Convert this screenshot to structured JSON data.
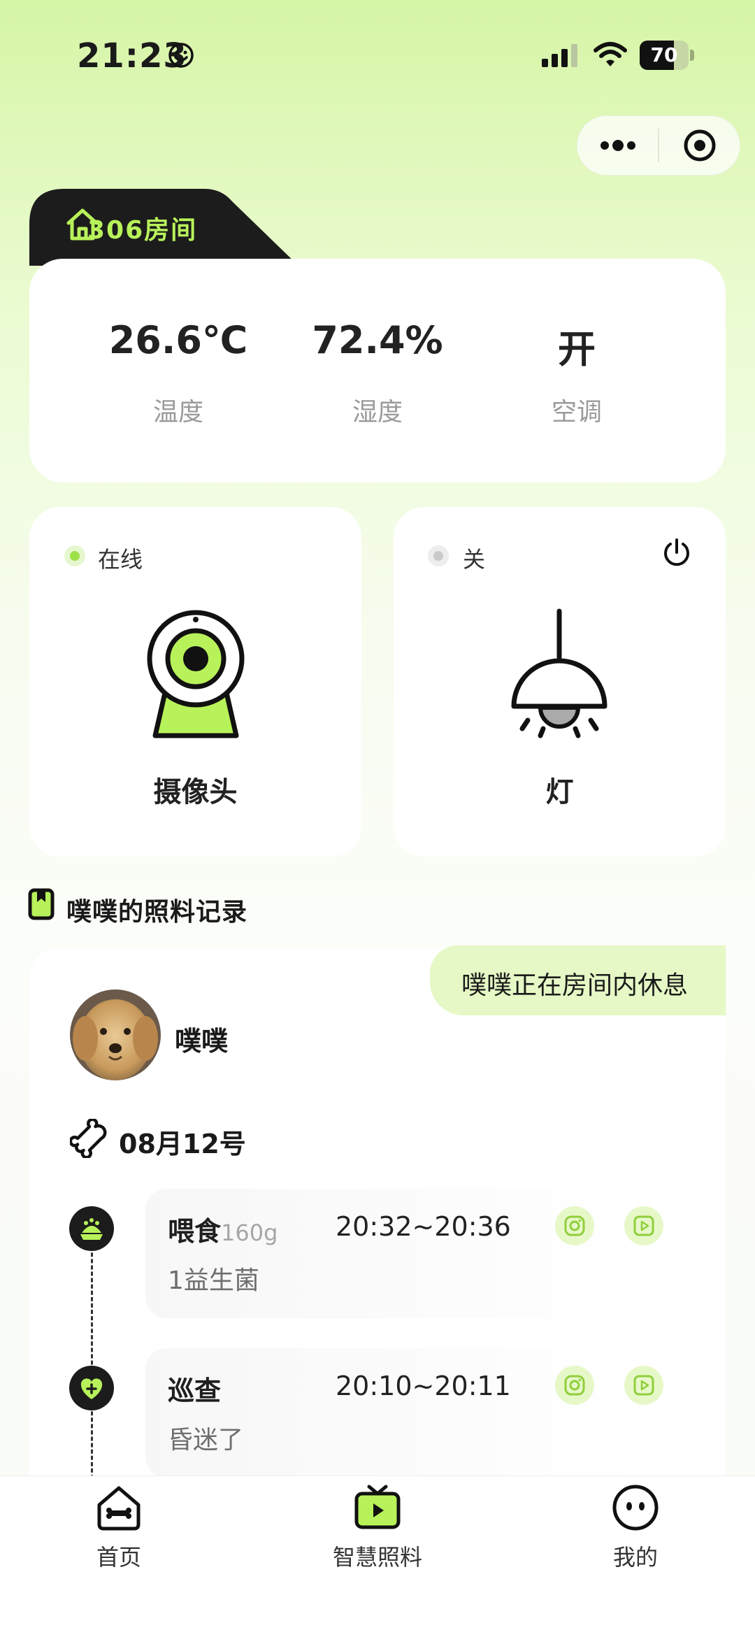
{
  "status_bar": {
    "time": "21:23",
    "battery": "70",
    "battery_level": 0.7
  },
  "room": {
    "title": "306房间"
  },
  "stats": [
    {
      "value": "26.6℃",
      "label": "温度"
    },
    {
      "value": "72.4%",
      "label": "湿度"
    },
    {
      "value": "开",
      "label": "空调"
    }
  ],
  "devices": {
    "camera": {
      "status": "在线",
      "name": "摄像头",
      "status_color": "#9ee04a"
    },
    "light": {
      "status": "关",
      "name": "灯",
      "status_color": "#c9c9c9"
    }
  },
  "section": {
    "title": "噗噗的照料记录"
  },
  "pet": {
    "name": "噗噗",
    "status_message": "噗噗正在房间内休息"
  },
  "date": "08月12号",
  "records": [
    {
      "title": "喂食",
      "amount": "160g",
      "time": "20:32~20:36",
      "note": "1益生菌",
      "icon": "food-bowl-icon"
    },
    {
      "title": "巡查",
      "amount": "",
      "time": "20:10~20:11",
      "note": "昏迷了",
      "icon": "heart-plus-icon"
    }
  ],
  "nav": [
    {
      "label": "首页",
      "icon": "home-bone-icon"
    },
    {
      "label": "智慧照料",
      "icon": "tv-play-icon"
    },
    {
      "label": "我的",
      "icon": "face-icon"
    }
  ],
  "colors": {
    "accent": "#b8f25a",
    "dark": "#1c1c1c"
  }
}
